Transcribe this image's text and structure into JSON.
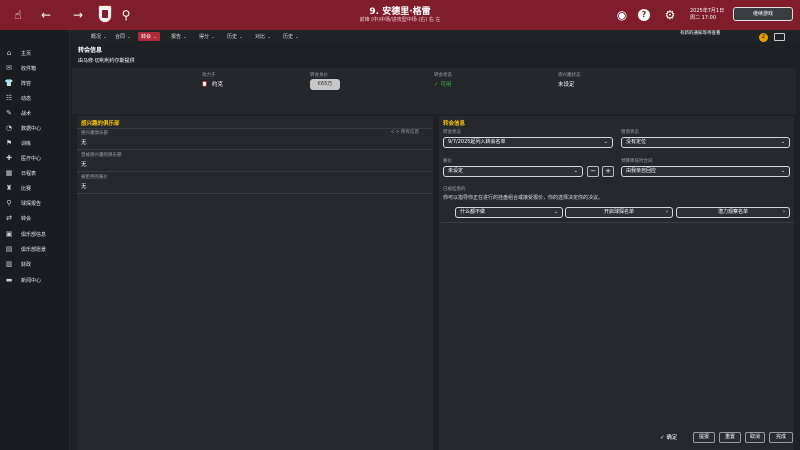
{
  "topbar": {
    "club_title": "9. 安德里·格雷",
    "club_sub": "前锋 (中)中场/进攻型中场 (右) 右 左",
    "date_line1": "2025年7月1日",
    "date_line2": "周二 17:00",
    "continue_label": "继续游戏"
  },
  "notice": {
    "line1": "有新的通知等待查看",
    "badge": "2"
  },
  "sidebar": {
    "items": [
      {
        "label": "主页",
        "icon": "home-icon",
        "glyph": "⌂"
      },
      {
        "label": "收件箱",
        "icon": "inbox-icon",
        "glyph": "✉"
      },
      {
        "label": "阵容",
        "icon": "squad-icon",
        "glyph": "👕"
      },
      {
        "label": "动态",
        "icon": "dynamics-icon",
        "glyph": "☷"
      },
      {
        "label": "战术",
        "icon": "tactics-icon",
        "glyph": "✎"
      },
      {
        "label": "数据中心",
        "icon": "data-hub-icon",
        "glyph": "◔"
      },
      {
        "label": "训练",
        "icon": "training-icon",
        "glyph": "⚑"
      },
      {
        "label": "医疗中心",
        "icon": "medical-icon",
        "glyph": "✚"
      },
      {
        "label": "日程表",
        "icon": "schedule-icon",
        "glyph": "▦"
      },
      {
        "label": "比赛",
        "icon": "competitions-icon",
        "glyph": "♜"
      },
      {
        "label": "球探报告",
        "icon": "scouting-icon",
        "glyph": "⚲"
      },
      {
        "label": "转会",
        "icon": "transfers-icon",
        "glyph": "⇄"
      },
      {
        "label": "俱乐部信息",
        "icon": "club-info-icon",
        "glyph": "▣"
      },
      {
        "label": "俱乐部愿景",
        "icon": "club-vision-icon",
        "glyph": "▤"
      },
      {
        "label": "财政",
        "icon": "finances-icon",
        "glyph": "▥"
      },
      {
        "label": "新闻中心",
        "icon": "news-icon",
        "glyph": "▬"
      }
    ]
  },
  "tabs": [
    {
      "label": "概况",
      "active": false
    },
    {
      "label": "合同",
      "active": false
    },
    {
      "label": "转会",
      "active": true
    },
    {
      "label": "报告",
      "active": false
    },
    {
      "label": "得分",
      "active": false
    },
    {
      "label": "历史",
      "active": false
    },
    {
      "label": "对比",
      "active": false
    },
    {
      "label": "历史",
      "active": false
    }
  ],
  "page": {
    "title": "转会信息",
    "subtitle": "由马修·切利利约尔斯提供"
  },
  "info": {
    "owner_label": "效力于",
    "owner_value": "约克",
    "value_label": "转会身价",
    "value_value": "€65万",
    "status_label": "转会状态",
    "status_value": "可用",
    "interest_label": "感兴趣状态",
    "interest_value": "未设定"
  },
  "left": {
    "header": "感兴趣的俱乐部",
    "header_right": "< > 所有信息",
    "rows": [
      {
        "label": "感兴趣俱乐部",
        "value": "无"
      },
      {
        "label": "曾被感兴趣的俱乐部",
        "value": "无"
      },
      {
        "label": "被拒绝的报价",
        "value": "无"
      }
    ]
  },
  "right": {
    "header": "转会信息",
    "status_label": "转会状态",
    "status_value": "9/7/2025起列入转会名单",
    "loan_label": "租借状态",
    "loan_value": "没有定位",
    "price_label": "要价",
    "price_value": "未设定",
    "minus": "−",
    "plus": "+",
    "contract_label": "预算降低时合同",
    "contract_value": "由我亲自回应",
    "actions_label": "已被挂盘的",
    "actions_desc": "你可以指导你正在进行的挂盘组合或接受报价，你的选择决定你的决议。",
    "btn1": "什么都不做",
    "btn2": "开启球探名单",
    "btn3": "潜力观察名单"
  },
  "footer": {
    "confirm": "确定",
    "b1": "提报",
    "b2": "重置",
    "b3": "取消",
    "b4": "完成"
  }
}
